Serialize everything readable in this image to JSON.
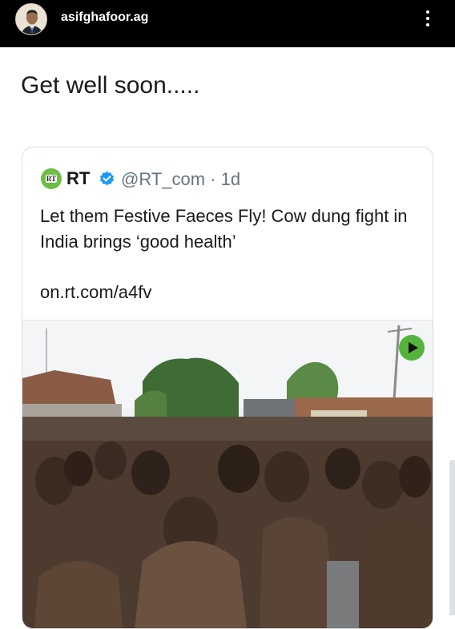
{
  "post": {
    "username": "asifghafoor.ag",
    "caption": "Get well soon....."
  },
  "tweet": {
    "author": "RT",
    "handle_time": "@RT_com · 1d",
    "logo_text": "RT",
    "text": "Let them Festive Faeces Fly! Cow dung fight in India brings ‘good health’",
    "link": "on.rt.com/a4fv"
  },
  "icons": {
    "menu": "more-vertical-icon",
    "verified": "verified-badge-icon",
    "play": "play-icon"
  },
  "colors": {
    "topbar": "#000000",
    "rt_green": "#6bbf43",
    "verified_blue": "#1d9bf0",
    "play_green": "#55b33c",
    "handle_gray": "#667580"
  }
}
